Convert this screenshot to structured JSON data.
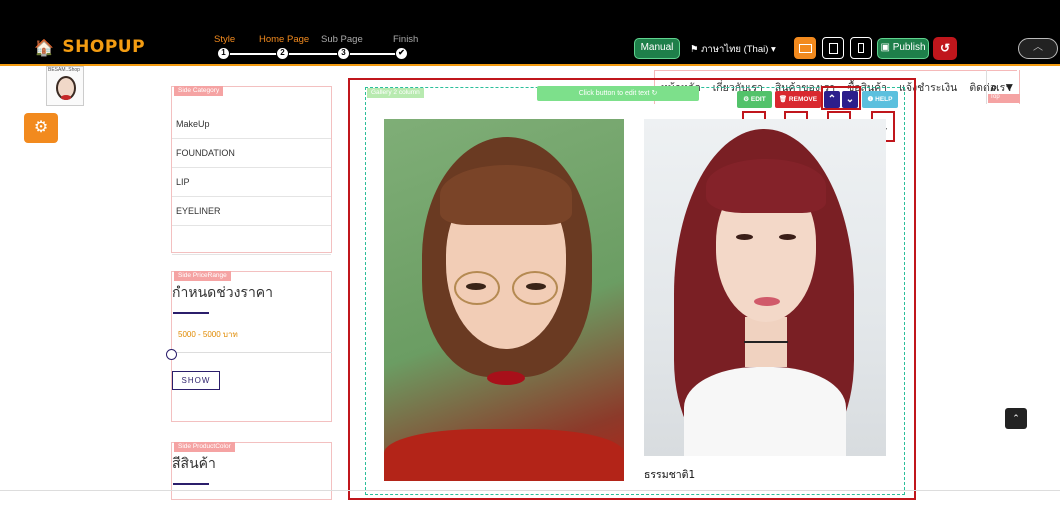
{
  "app": {
    "logo_text": "SHOPUP"
  },
  "wizard": {
    "steps": [
      {
        "label": "Style",
        "number": "1",
        "color": "#f28a1e"
      },
      {
        "label": "Home Page",
        "number": "2",
        "color": "#f28a1e"
      },
      {
        "label": "Sub Page",
        "number": "3",
        "color": "#aaaaaa"
      },
      {
        "label": "Finish",
        "number": "✔",
        "color": "#aaaaaa"
      }
    ]
  },
  "toolbar": {
    "manual_label": "Manual",
    "language_label": "ภาษาไทย (Thai) ▾",
    "publish_label": "Publish",
    "undo_symbol": "↺",
    "collapse_symbol": "︿"
  },
  "shop": {
    "logo_caption": "BESAM..Shop"
  },
  "nav": {
    "items": [
      "หน้าหลัก",
      "เกี่ยวกับเรา",
      "สินค้าของเรา",
      "ซื้อสินค้า",
      "แจ้งชำระเงิน",
      "ติดต่อเรา"
    ],
    "top_tag": "Top",
    "search_symbol": "🔍",
    "cart_symbol": "🛒"
  },
  "sidebar": {
    "category": {
      "tag": "Side Category",
      "items": [
        "MakeUp",
        "FOUNDATION",
        "LIP",
        "EYELINER",
        ""
      ]
    },
    "price_range": {
      "tag": "Side PriceRange",
      "heading": "กำหนดช่วงราคา",
      "range_text": "5000 - 5000 บาท",
      "show_label": "SHOW"
    },
    "product_color": {
      "tag": "Side ProductColor",
      "heading": "สีสินค้า"
    }
  },
  "gallery": {
    "section_tag": "Gallery 2 column",
    "edit_hint": "Click button to edit text ↻",
    "tools": {
      "edit_label": "⚙ EDIT",
      "remove_label": "🗑 REMOVE",
      "up_symbol": "⌃",
      "down_symbol": "⌄",
      "help_label": "❶ HELP"
    },
    "callouts": [
      "1",
      "2",
      "3",
      "4"
    ],
    "photos": [
      {
        "caption": ""
      },
      {
        "caption": "ธรรมชาติ1"
      }
    ]
  },
  "scroll_top_symbol": "⌃",
  "colors": {
    "accent_orange": "#f28a1e",
    "callout_red": "#c0161c",
    "edit_green": "#52c26a",
    "remove_red": "#d9282f",
    "move_navy": "#2b1e8c",
    "help_blue": "#5bc0de",
    "publish_green": "#1e7f4a"
  }
}
